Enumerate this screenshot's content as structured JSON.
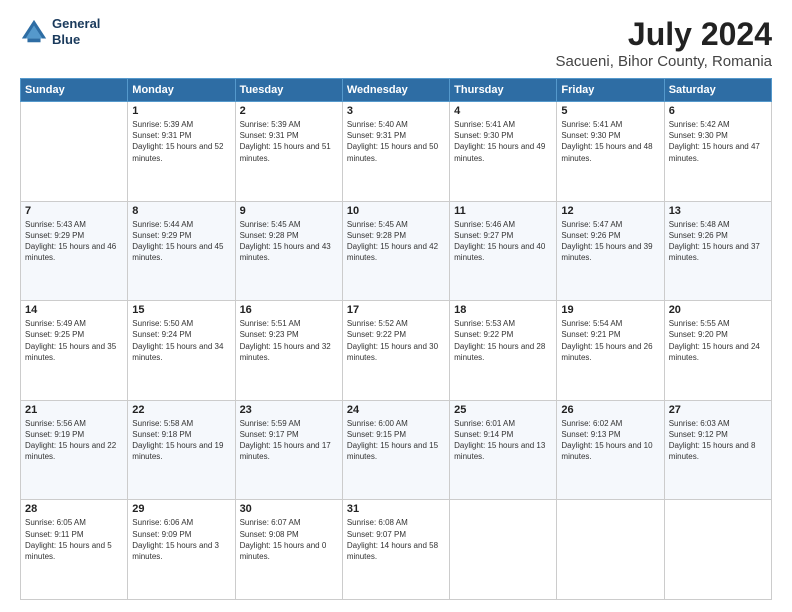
{
  "header": {
    "logo_line1": "General",
    "logo_line2": "Blue",
    "title": "July 2024",
    "subtitle": "Sacueni, Bihor County, Romania"
  },
  "weekdays": [
    "Sunday",
    "Monday",
    "Tuesday",
    "Wednesday",
    "Thursday",
    "Friday",
    "Saturday"
  ],
  "weeks": [
    [
      {
        "day": "",
        "sunrise": "",
        "sunset": "",
        "daylight": ""
      },
      {
        "day": "1",
        "sunrise": "Sunrise: 5:39 AM",
        "sunset": "Sunset: 9:31 PM",
        "daylight": "Daylight: 15 hours and 52 minutes."
      },
      {
        "day": "2",
        "sunrise": "Sunrise: 5:39 AM",
        "sunset": "Sunset: 9:31 PM",
        "daylight": "Daylight: 15 hours and 51 minutes."
      },
      {
        "day": "3",
        "sunrise": "Sunrise: 5:40 AM",
        "sunset": "Sunset: 9:31 PM",
        "daylight": "Daylight: 15 hours and 50 minutes."
      },
      {
        "day": "4",
        "sunrise": "Sunrise: 5:41 AM",
        "sunset": "Sunset: 9:30 PM",
        "daylight": "Daylight: 15 hours and 49 minutes."
      },
      {
        "day": "5",
        "sunrise": "Sunrise: 5:41 AM",
        "sunset": "Sunset: 9:30 PM",
        "daylight": "Daylight: 15 hours and 48 minutes."
      },
      {
        "day": "6",
        "sunrise": "Sunrise: 5:42 AM",
        "sunset": "Sunset: 9:30 PM",
        "daylight": "Daylight: 15 hours and 47 minutes."
      }
    ],
    [
      {
        "day": "7",
        "sunrise": "Sunrise: 5:43 AM",
        "sunset": "Sunset: 9:29 PM",
        "daylight": "Daylight: 15 hours and 46 minutes."
      },
      {
        "day": "8",
        "sunrise": "Sunrise: 5:44 AM",
        "sunset": "Sunset: 9:29 PM",
        "daylight": "Daylight: 15 hours and 45 minutes."
      },
      {
        "day": "9",
        "sunrise": "Sunrise: 5:45 AM",
        "sunset": "Sunset: 9:28 PM",
        "daylight": "Daylight: 15 hours and 43 minutes."
      },
      {
        "day": "10",
        "sunrise": "Sunrise: 5:45 AM",
        "sunset": "Sunset: 9:28 PM",
        "daylight": "Daylight: 15 hours and 42 minutes."
      },
      {
        "day": "11",
        "sunrise": "Sunrise: 5:46 AM",
        "sunset": "Sunset: 9:27 PM",
        "daylight": "Daylight: 15 hours and 40 minutes."
      },
      {
        "day": "12",
        "sunrise": "Sunrise: 5:47 AM",
        "sunset": "Sunset: 9:26 PM",
        "daylight": "Daylight: 15 hours and 39 minutes."
      },
      {
        "day": "13",
        "sunrise": "Sunrise: 5:48 AM",
        "sunset": "Sunset: 9:26 PM",
        "daylight": "Daylight: 15 hours and 37 minutes."
      }
    ],
    [
      {
        "day": "14",
        "sunrise": "Sunrise: 5:49 AM",
        "sunset": "Sunset: 9:25 PM",
        "daylight": "Daylight: 15 hours and 35 minutes."
      },
      {
        "day": "15",
        "sunrise": "Sunrise: 5:50 AM",
        "sunset": "Sunset: 9:24 PM",
        "daylight": "Daylight: 15 hours and 34 minutes."
      },
      {
        "day": "16",
        "sunrise": "Sunrise: 5:51 AM",
        "sunset": "Sunset: 9:23 PM",
        "daylight": "Daylight: 15 hours and 32 minutes."
      },
      {
        "day": "17",
        "sunrise": "Sunrise: 5:52 AM",
        "sunset": "Sunset: 9:22 PM",
        "daylight": "Daylight: 15 hours and 30 minutes."
      },
      {
        "day": "18",
        "sunrise": "Sunrise: 5:53 AM",
        "sunset": "Sunset: 9:22 PM",
        "daylight": "Daylight: 15 hours and 28 minutes."
      },
      {
        "day": "19",
        "sunrise": "Sunrise: 5:54 AM",
        "sunset": "Sunset: 9:21 PM",
        "daylight": "Daylight: 15 hours and 26 minutes."
      },
      {
        "day": "20",
        "sunrise": "Sunrise: 5:55 AM",
        "sunset": "Sunset: 9:20 PM",
        "daylight": "Daylight: 15 hours and 24 minutes."
      }
    ],
    [
      {
        "day": "21",
        "sunrise": "Sunrise: 5:56 AM",
        "sunset": "Sunset: 9:19 PM",
        "daylight": "Daylight: 15 hours and 22 minutes."
      },
      {
        "day": "22",
        "sunrise": "Sunrise: 5:58 AM",
        "sunset": "Sunset: 9:18 PM",
        "daylight": "Daylight: 15 hours and 19 minutes."
      },
      {
        "day": "23",
        "sunrise": "Sunrise: 5:59 AM",
        "sunset": "Sunset: 9:17 PM",
        "daylight": "Daylight: 15 hours and 17 minutes."
      },
      {
        "day": "24",
        "sunrise": "Sunrise: 6:00 AM",
        "sunset": "Sunset: 9:15 PM",
        "daylight": "Daylight: 15 hours and 15 minutes."
      },
      {
        "day": "25",
        "sunrise": "Sunrise: 6:01 AM",
        "sunset": "Sunset: 9:14 PM",
        "daylight": "Daylight: 15 hours and 13 minutes."
      },
      {
        "day": "26",
        "sunrise": "Sunrise: 6:02 AM",
        "sunset": "Sunset: 9:13 PM",
        "daylight": "Daylight: 15 hours and 10 minutes."
      },
      {
        "day": "27",
        "sunrise": "Sunrise: 6:03 AM",
        "sunset": "Sunset: 9:12 PM",
        "daylight": "Daylight: 15 hours and 8 minutes."
      }
    ],
    [
      {
        "day": "28",
        "sunrise": "Sunrise: 6:05 AM",
        "sunset": "Sunset: 9:11 PM",
        "daylight": "Daylight: 15 hours and 5 minutes."
      },
      {
        "day": "29",
        "sunrise": "Sunrise: 6:06 AM",
        "sunset": "Sunset: 9:09 PM",
        "daylight": "Daylight: 15 hours and 3 minutes."
      },
      {
        "day": "30",
        "sunrise": "Sunrise: 6:07 AM",
        "sunset": "Sunset: 9:08 PM",
        "daylight": "Daylight: 15 hours and 0 minutes."
      },
      {
        "day": "31",
        "sunrise": "Sunrise: 6:08 AM",
        "sunset": "Sunset: 9:07 PM",
        "daylight": "Daylight: 14 hours and 58 minutes."
      },
      {
        "day": "",
        "sunrise": "",
        "sunset": "",
        "daylight": ""
      },
      {
        "day": "",
        "sunrise": "",
        "sunset": "",
        "daylight": ""
      },
      {
        "day": "",
        "sunrise": "",
        "sunset": "",
        "daylight": ""
      }
    ]
  ]
}
